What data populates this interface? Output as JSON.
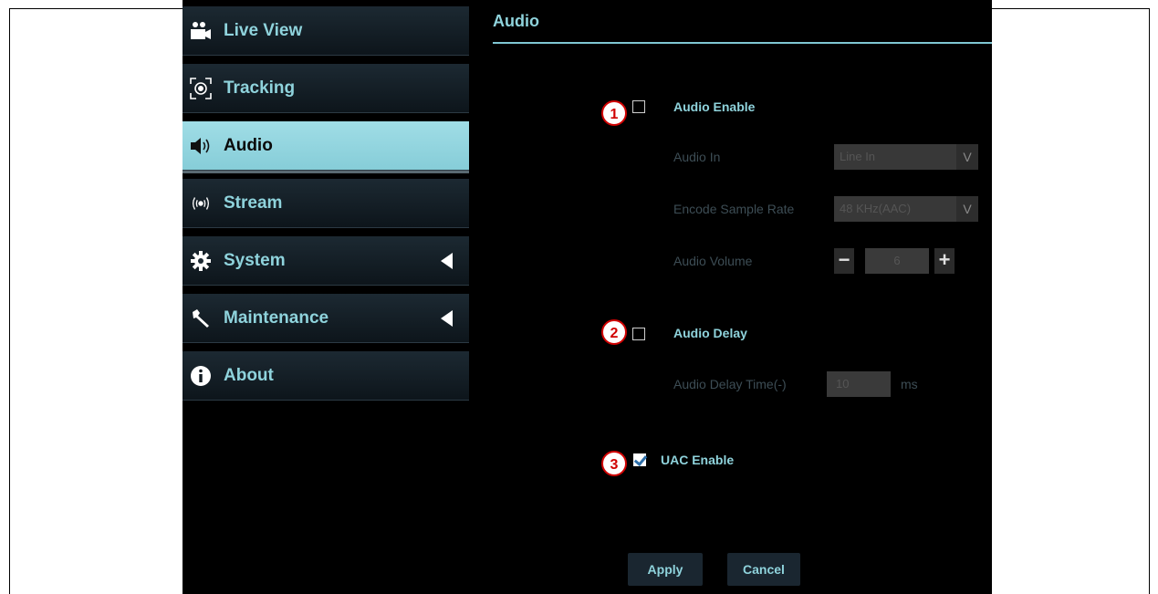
{
  "sidebar": {
    "items": [
      {
        "label": "Live View",
        "icon": "camera-icon",
        "active": false,
        "has_arrow": false
      },
      {
        "label": "Tracking",
        "icon": "tracking-target-icon",
        "active": false,
        "has_arrow": false
      },
      {
        "label": "Audio",
        "icon": "speaker-icon",
        "active": true,
        "has_arrow": false
      },
      {
        "label": "Stream",
        "icon": "broadcast-icon",
        "active": false,
        "has_arrow": false
      },
      {
        "label": "System",
        "icon": "gear-icon",
        "active": false,
        "has_arrow": true
      },
      {
        "label": "Maintenance",
        "icon": "wrench-icon",
        "active": false,
        "has_arrow": true
      },
      {
        "label": "About",
        "icon": "info-icon",
        "active": false,
        "has_arrow": false
      }
    ]
  },
  "main": {
    "title": "Audio",
    "audio_enable": {
      "label": "Audio Enable",
      "checked": false,
      "callout": "1"
    },
    "audio_in": {
      "label": "Audio In",
      "value": "Line In",
      "arrow": "V"
    },
    "sample_rate": {
      "label": "Encode Sample Rate",
      "value": "48 KHz(AAC)",
      "arrow": "V"
    },
    "volume": {
      "label": "Audio Volume",
      "value": "6",
      "minus": "−",
      "plus": "+"
    },
    "audio_delay": {
      "label": "Audio Delay",
      "checked": false,
      "callout": "2"
    },
    "delay_time": {
      "label": "Audio Delay Time(-)",
      "value": "10",
      "unit": "ms"
    },
    "uac_enable": {
      "label": "UAC Enable",
      "checked": true,
      "callout": "3"
    },
    "apply_label": "Apply",
    "cancel_label": "Cancel"
  },
  "colors": {
    "accent": "#8fd3dc",
    "active_bg": "#a0dde6",
    "callout": "#d00000"
  }
}
